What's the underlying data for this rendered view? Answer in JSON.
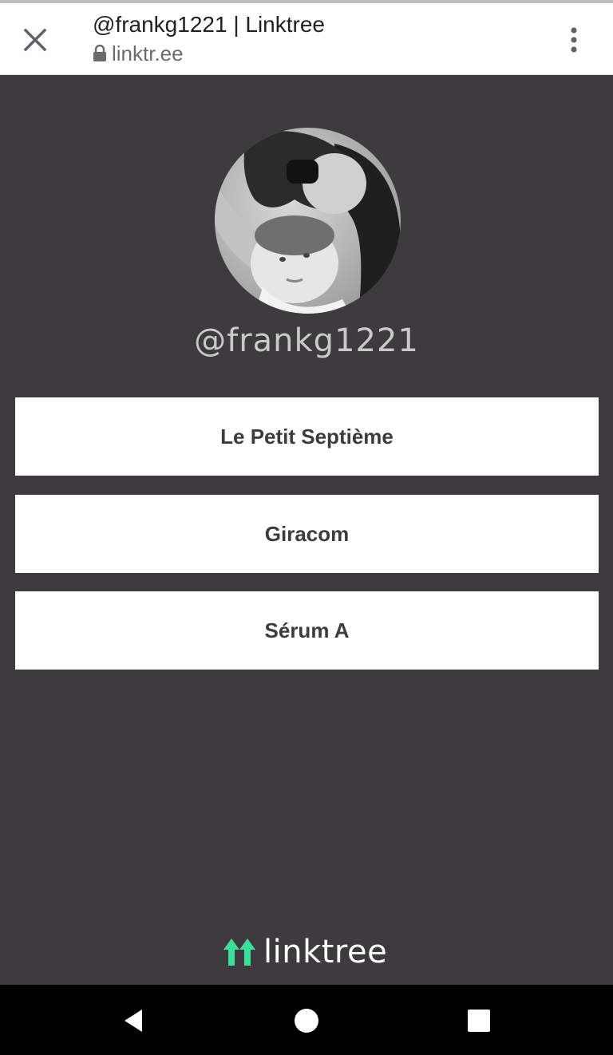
{
  "browser": {
    "title": "@frankg1221 | Linktree",
    "url": "linktr.ee",
    "close_icon": "close-icon",
    "menu_icon": "more-vert-icon"
  },
  "profile": {
    "username": "@frankg1221",
    "avatar": "profile-photo"
  },
  "links": [
    {
      "label": "Le Petit Septième"
    },
    {
      "label": "Giracom"
    },
    {
      "label": "Sérum A"
    }
  ],
  "footer": {
    "logo_text": "linktree",
    "logo_color": "#39e09b"
  },
  "colors": {
    "background": "#3d3b3d",
    "button": "#ffffff",
    "button_text": "#3d3b3d"
  },
  "system_nav": [
    "back-icon",
    "home-icon",
    "recents-icon"
  ]
}
